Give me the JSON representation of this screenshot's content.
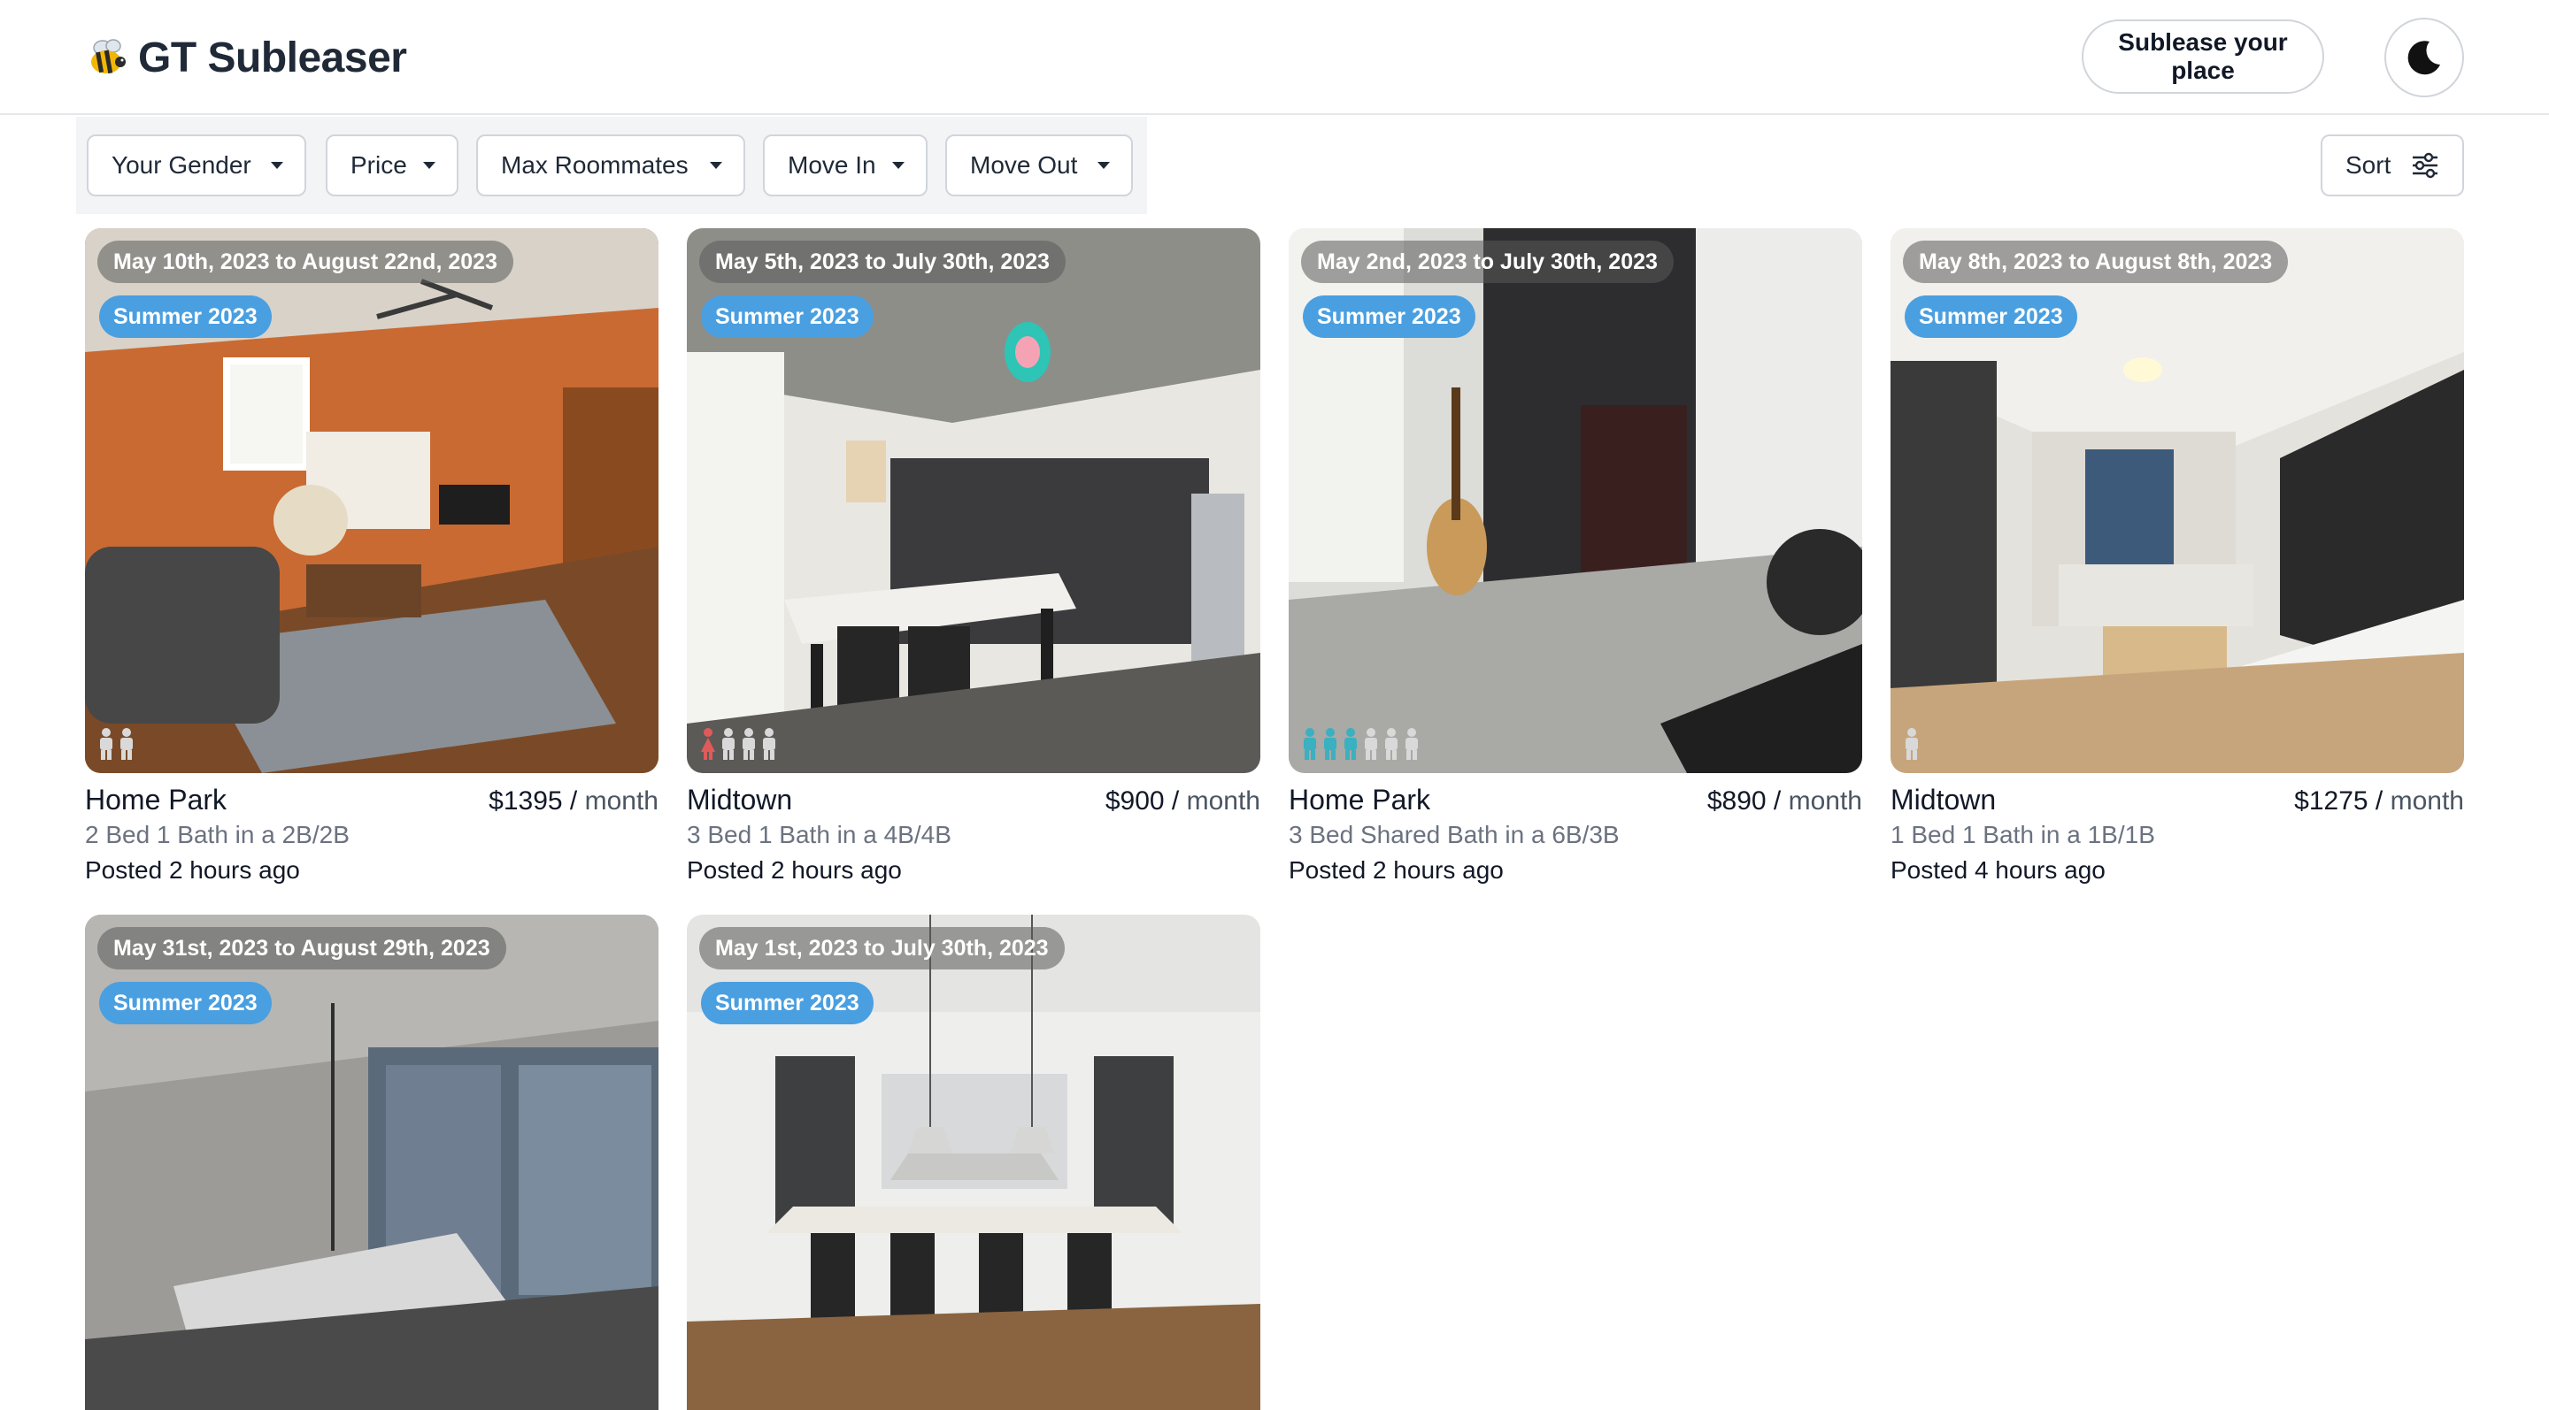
{
  "header": {
    "brand_title": "GT Subleaser",
    "brand_icon": "bee-icon",
    "sublease_button": "Sublease your place",
    "theme_icon": "moon-icon"
  },
  "filters": [
    {
      "label": "Your Gender"
    },
    {
      "label": "Price"
    },
    {
      "label": "Max Roommates"
    },
    {
      "label": "Move In"
    },
    {
      "label": "Move Out"
    }
  ],
  "sort": {
    "label": "Sort",
    "icon": "sliders-icon"
  },
  "listings": [
    {
      "dates": "May 10th, 2023 to August 22nd, 2023",
      "term": "Summer 2023",
      "location": "Home Park",
      "price": "$1395",
      "per": "month",
      "description": "2 Bed 1 Bath in a 2B/2B",
      "posted": "Posted 2 hours ago",
      "roommates": [
        "empty",
        "empty"
      ]
    },
    {
      "dates": "May 5th, 2023 to July 30th, 2023",
      "term": "Summer 2023",
      "location": "Midtown",
      "price": "$900",
      "per": "month",
      "description": "3 Bed 1 Bath in a 4B/4B",
      "posted": "Posted 2 hours ago",
      "roommates": [
        "female",
        "empty",
        "empty",
        "empty"
      ]
    },
    {
      "dates": "May 2nd, 2023 to July 30th, 2023",
      "term": "Summer 2023",
      "location": "Home Park",
      "price": "$890",
      "per": "month",
      "description": "3 Bed Shared Bath in a 6B/3B",
      "posted": "Posted 2 hours ago",
      "roommates": [
        "male",
        "male",
        "male",
        "empty",
        "empty",
        "empty"
      ]
    },
    {
      "dates": "May 8th, 2023 to August 8th, 2023",
      "term": "Summer 2023",
      "location": "Midtown",
      "price": "$1275",
      "per": "month",
      "description": "1 Bed 1 Bath in a 1B/1B",
      "posted": "Posted 4 hours ago",
      "roommates": [
        "empty"
      ]
    },
    {
      "dates": "May 31st, 2023 to August 29th, 2023",
      "term": "Summer 2023"
    },
    {
      "dates": "May 1st, 2023 to July 30th, 2023",
      "term": "Summer 2023"
    }
  ],
  "colors": {
    "badge_blue": "#4a9fe0",
    "female_person": "#e05a5a",
    "male_person": "#3ab0c0",
    "empty_person": "#d9d9d9"
  }
}
